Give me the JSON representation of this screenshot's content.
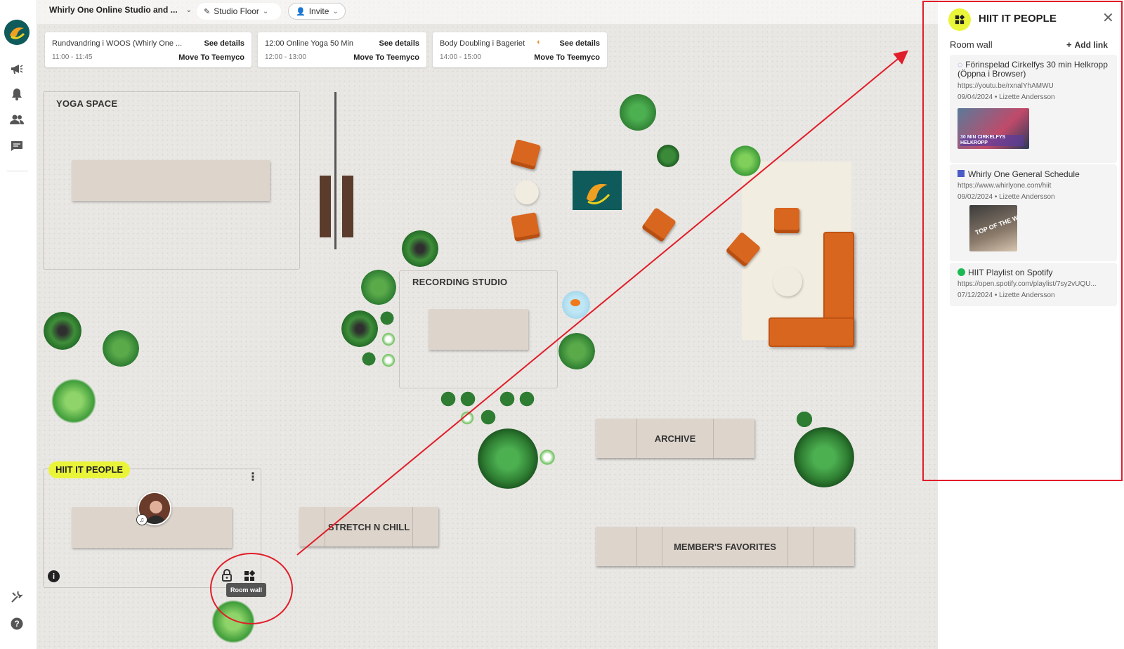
{
  "header": {
    "workspace": "Whirly One Online Studio and ...",
    "floor": "Studio Floor",
    "invite": "Invite"
  },
  "events": [
    {
      "title": "Rundvandring i WOOS (Whirly One ...",
      "time": "11:00 - 11:45",
      "details": "See details",
      "move": "Move To Teemyco"
    },
    {
      "title": "12:00 Online Yoga 50 Min",
      "time": "12:00 - 13:00",
      "details": "See details",
      "move": "Move To Teemyco"
    },
    {
      "title": "Body Doubling i Bageriet",
      "time": "14:00 - 15:00",
      "details": "See details",
      "move": "Move To Teemyco"
    }
  ],
  "rooms": {
    "yoga": "YOGA SPACE",
    "recording": "RECORDING STUDIO",
    "archive": "ARCHIVE",
    "stretch": "STRETCH N CHILL",
    "favorites": "MEMBER'S FAVORITES",
    "hiit": "HIIT IT PEOPLE"
  },
  "tooltip": "Room wall",
  "panel": {
    "title": "HIIT IT PEOPLE",
    "subtitle": "Room wall",
    "add_link": "Add link",
    "links": [
      {
        "title": "Förinspelad Cirkelfys 30 min Helkropp (Öppna i Browser)",
        "url": "https://youtu.be/rxnalYhAMWU",
        "meta": "09/04/2024 • Lizette Andersson",
        "thumb_text": "30 MIN CIRKELFYS HELKROPP"
      },
      {
        "title": "Whirly One General Schedule",
        "url": "https://www.whirlyone.com/hiit",
        "meta": "09/02/2024 • Lizette Andersson",
        "thumb_text": "TOP OF THE WHIRL"
      },
      {
        "title": "HIIT Playlist on Spotify",
        "url": "https://open.spotify.com/playlist/7sy2vUQU...",
        "meta": "07/12/2024 • Lizette Andersson"
      }
    ]
  },
  "colors": {
    "accent": "#eaf53a",
    "annotation": "#e11d2a",
    "furniture": "#d9661f"
  }
}
